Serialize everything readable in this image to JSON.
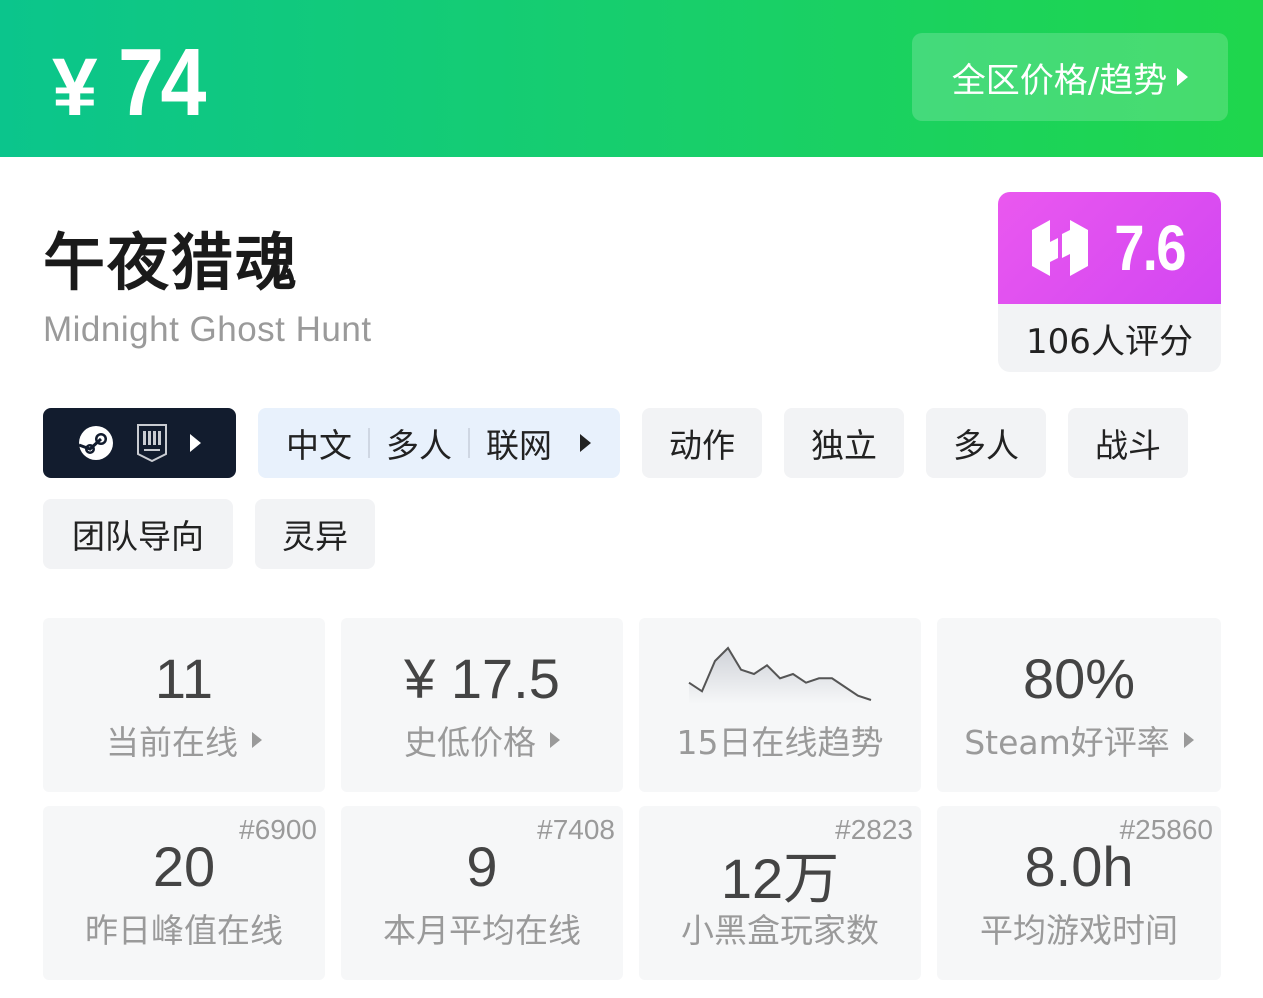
{
  "header": {
    "currency": "¥",
    "price": "74",
    "region_button": "全区价格/趋势"
  },
  "game": {
    "title": "午夜猎魂",
    "subtitle": "Midnight Ghost Hunt"
  },
  "score": {
    "value": "7.6",
    "raters": "106人评分",
    "logo_icon": "heybox-logo-icon",
    "color": "#e356f0"
  },
  "platforms": [
    "steam-icon",
    "epic-games-icon"
  ],
  "features": [
    "中文",
    "多人",
    "联网"
  ],
  "tags": [
    "动作",
    "独立",
    "多人",
    "战斗",
    "团队导向",
    "灵异"
  ],
  "stats": {
    "current_online": {
      "value": "11",
      "label": "当前在线"
    },
    "lowest_price": {
      "value": "¥ 17.5",
      "label": "史低价格"
    },
    "trend": {
      "label": "15日在线趋势",
      "points": [
        6,
        4,
        11,
        14,
        9,
        8,
        10,
        7,
        8,
        6,
        7,
        7,
        5,
        3,
        2
      ]
    },
    "steam_rating": {
      "value": "80%",
      "label": "Steam好评率"
    },
    "yesterday_peak": {
      "value": "20",
      "rank": "#6900",
      "label": "昨日峰值在线"
    },
    "monthly_avg": {
      "value": "9",
      "rank": "#7408",
      "label": "本月平均在线"
    },
    "heybox_players": {
      "value": "12万",
      "rank": "#2823",
      "label": "小黑盒玩家数"
    },
    "avg_playtime": {
      "value": "8.0h",
      "rank": "#25860",
      "label": "平均游戏时间"
    }
  }
}
